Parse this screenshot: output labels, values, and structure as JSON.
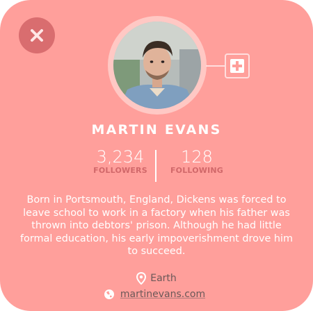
{
  "profile": {
    "name": "MARTIN EVANS",
    "bio": "Born in Portsmouth, England, Dickens was forced to leave school to work in a factory when his father was thrown into debtors' prison. Although he had little formal education, his early impoverishment drove him to succeed.",
    "location": "Earth",
    "website": "martinevans.com"
  },
  "stats": {
    "followers": {
      "value": "3,234",
      "label": "FOLLOWERS"
    },
    "following": {
      "value": "128",
      "label": "FOLLOWING"
    }
  },
  "icons": {
    "close": "close-icon",
    "add": "plus-icon",
    "location": "location-pin-icon",
    "website": "globe-icon"
  },
  "colors": {
    "card_background": "#ff9f9b",
    "close_button": "#d96d6f",
    "stat_label": "#d1686a",
    "muted_text": "#6a5858"
  }
}
